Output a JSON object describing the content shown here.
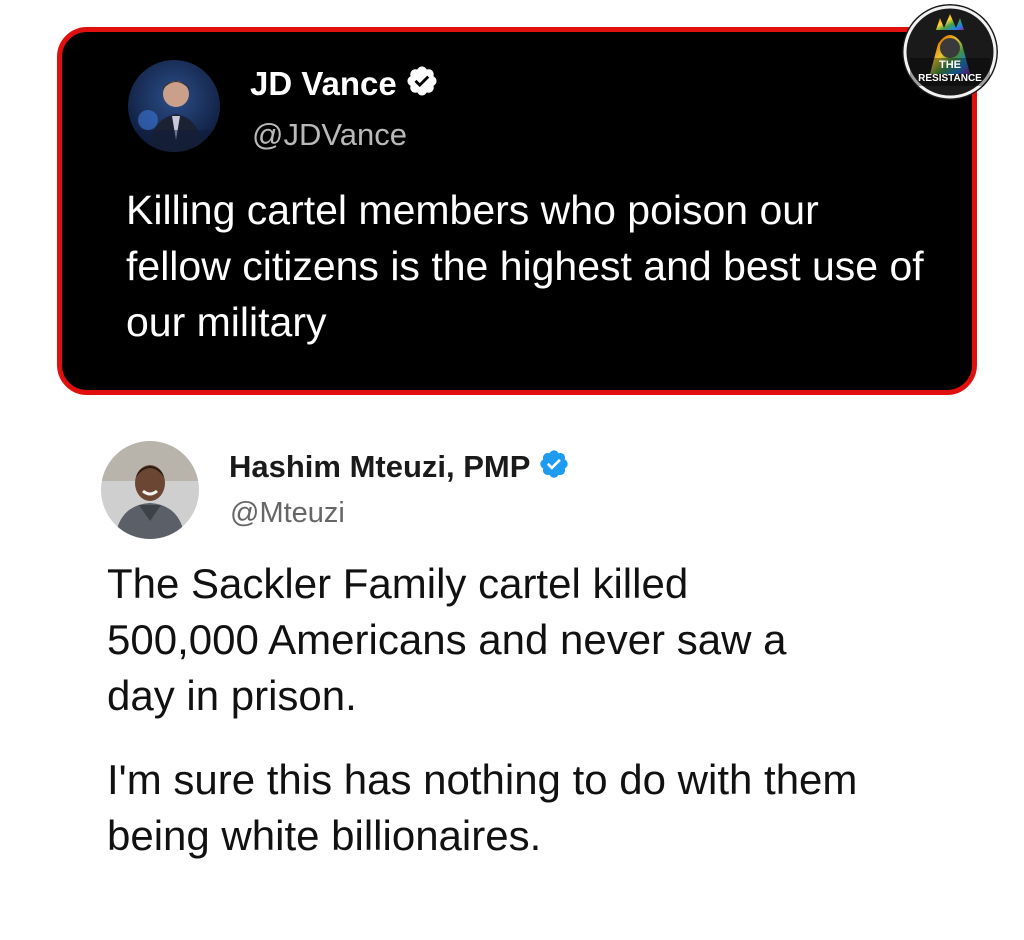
{
  "tweet_top": {
    "display_name": "JD Vance",
    "handle": "@JDVance",
    "verified": true,
    "text": "Killing cartel members who poison our fellow citizens is the highest and best use of our military"
  },
  "tweet_bottom": {
    "display_name": "Hashim Mteuzi, PMP",
    "handle": "@Mteuzi",
    "verified": true,
    "paragraphs": [
      "The Sackler Family cartel killed 500,000 Americans and never saw a day in prison.",
      "I'm sure this has nothing to do with them being white billionaires."
    ]
  },
  "watermark": {
    "line1": "THE",
    "line2": "RESISTANCE"
  },
  "colors": {
    "frame_red": "#e0100f",
    "verified_blue": "#1d9bf0",
    "dark_bg": "#000000"
  },
  "icons": {
    "verified": "verified-badge-icon"
  }
}
